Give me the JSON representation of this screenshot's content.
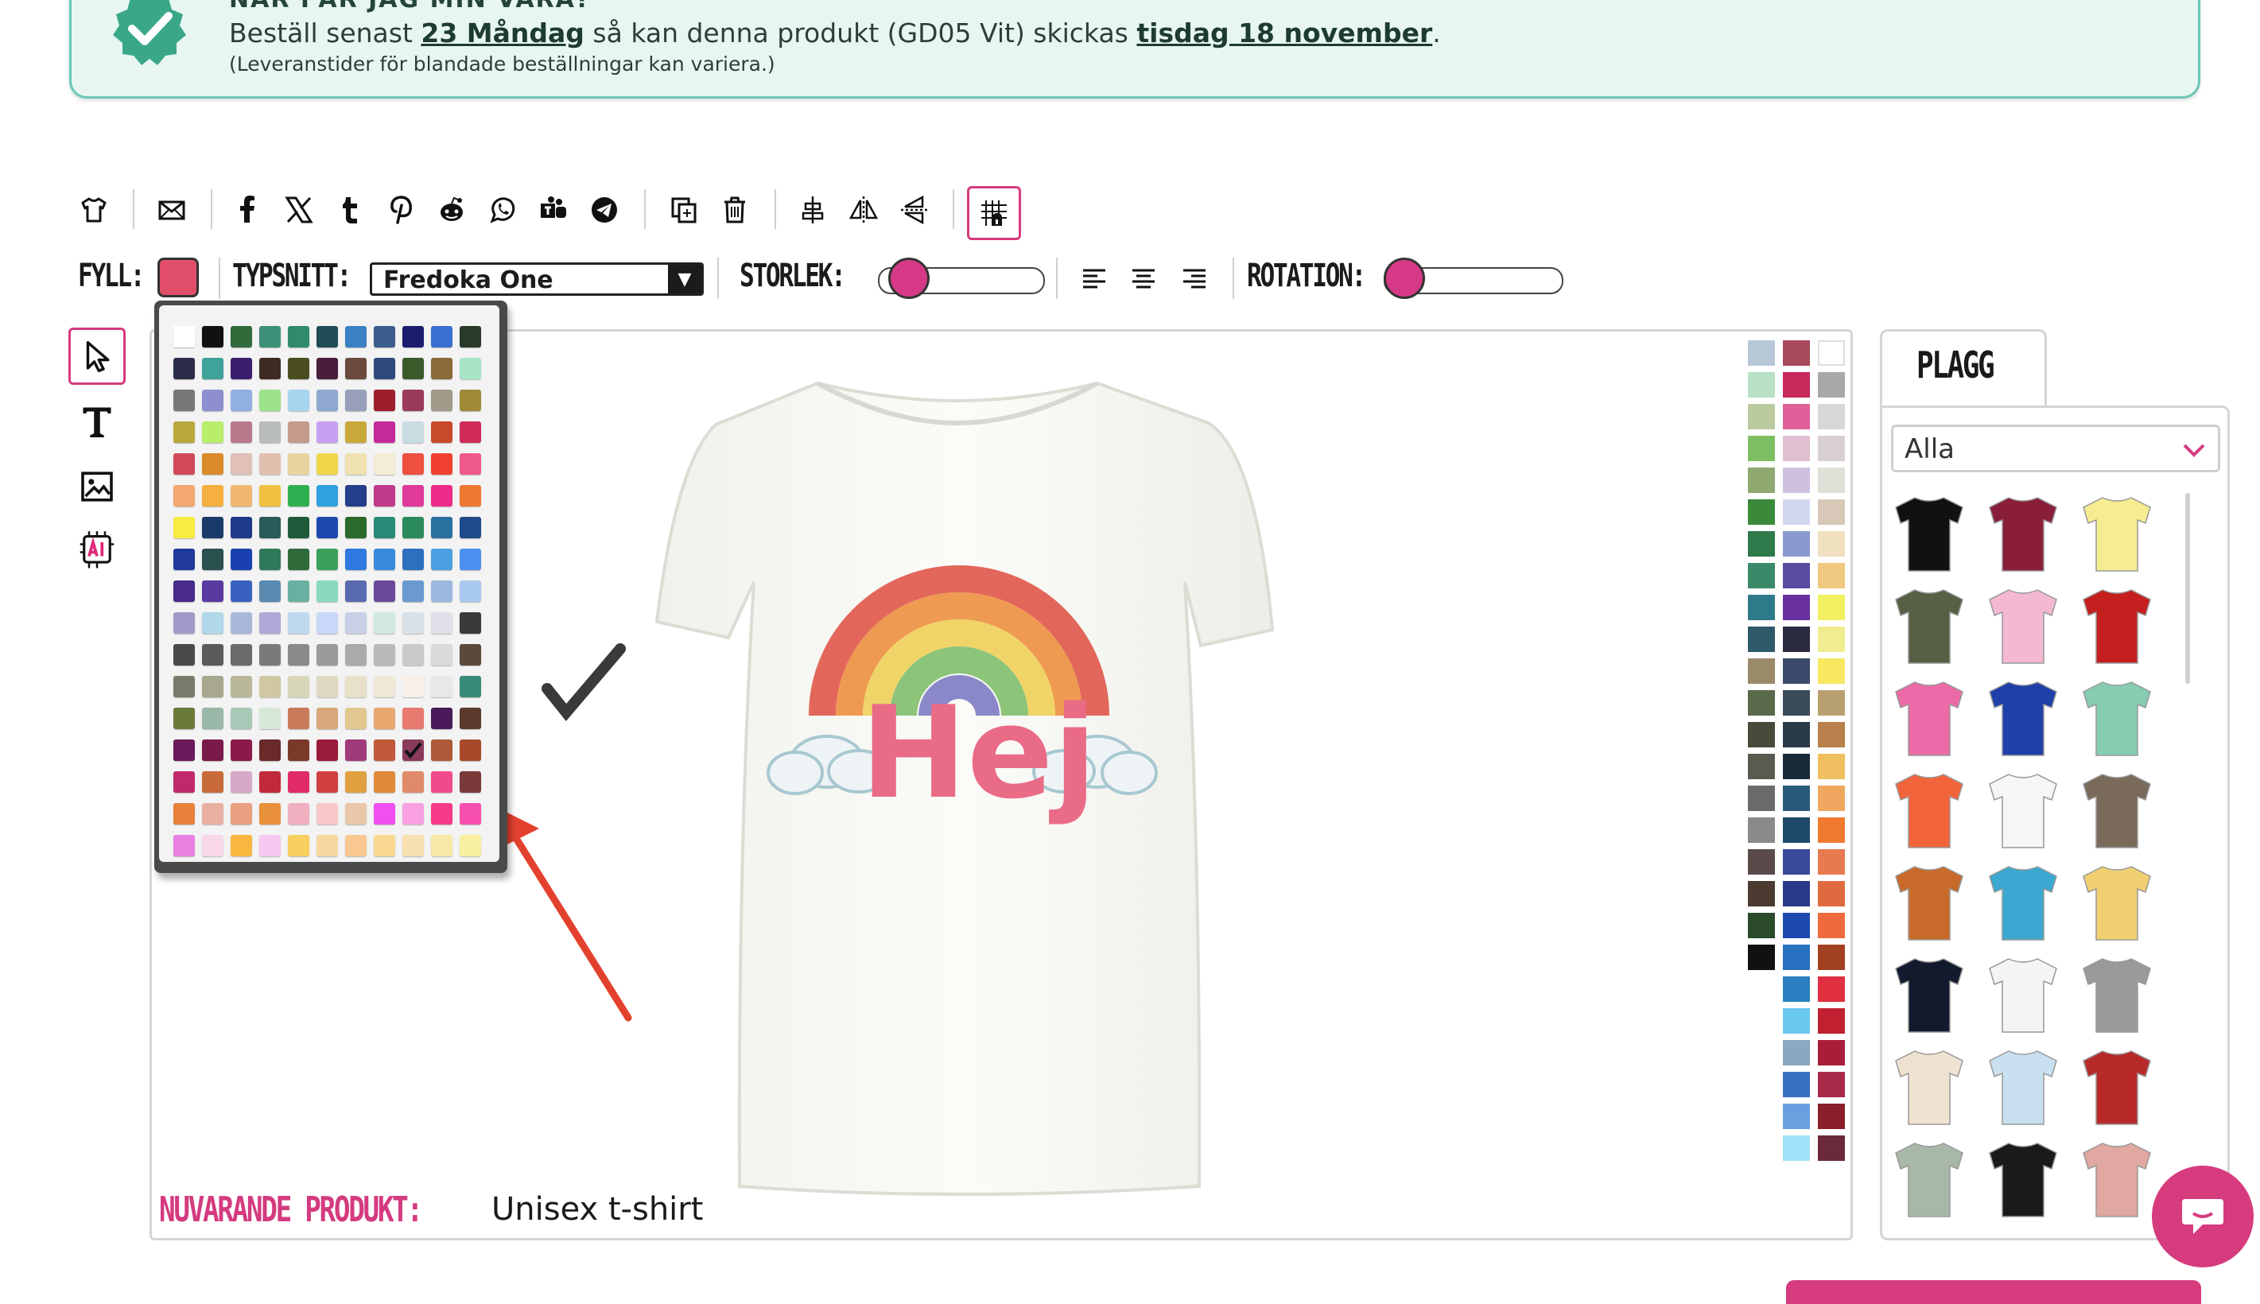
{
  "banner": {
    "title": "NÄR FÅR JAG MIN VARA?",
    "line_prefix": "Beställ senast ",
    "deadline": "23 Måndag",
    "line_middle": " så kan denna produkt (GD05 Vit) skickas ",
    "ship_date": "tisdag 18 november",
    "line_suffix": ".",
    "note": "(Leveranstider för blandade beställningar kan variera.)"
  },
  "toolbar_icons": [
    "tshirt-icon",
    "mail-icon",
    "facebook-icon",
    "x-icon",
    "tumblr-icon",
    "pinterest-icon",
    "reddit-icon",
    "whatsapp-icon",
    "teams-icon",
    "telegram-icon",
    "duplicate-icon",
    "trash-icon",
    "align-center-icon",
    "flip-horizontal-icon",
    "flip-vertical-icon",
    "snap-grid-icon"
  ],
  "props": {
    "fill_label": "FYLL:",
    "fill_color": "#e14e6a",
    "font_label": "TYPSNITT:",
    "font_value": "Fredoka One",
    "size_label": "STORLEK:",
    "size_level": 0.1,
    "rotation_label": "ROTATION:",
    "rotation_level": 0.0
  },
  "tools": [
    "select-tool-icon",
    "text-tool-icon",
    "image-tool-icon",
    "ai-tool-icon"
  ],
  "palette_popup": {
    "selected_index": 151,
    "colors": [
      "#ffffff",
      "#111111",
      "#2f6a3a",
      "#3d8f77",
      "#2f8a6e",
      "#1f4c57",
      "#3b7fc4",
      "#3a5c8e",
      "#1b1e6e",
      "#3a6fd0",
      "#2a3a2a",
      "#2b2d4a",
      "#3fa39a",
      "#3b1e6b",
      "#3d2b22",
      "#4b4d1f",
      "#4a1d3c",
      "#6b4a3e",
      "#2d4a7a",
      "#3b5a2a",
      "#8b6a3b",
      "#a8e4c8",
      "#777777",
      "#8f8fcf",
      "#8fb0e0",
      "#9be28a",
      "#a7d4ee",
      "#8fa8d0",
      "#97a0b8",
      "#9b1e2a",
      "#9a3b5a",
      "#a29a8a",
      "#a08a3a",
      "#b8a83a",
      "#b8ee6a",
      "#b87a8a",
      "#b8bcba",
      "#c49a8a",
      "#c7a0f2",
      "#c9a83a",
      "#c42a9a",
      "#c8dce2",
      "#c84a2a",
      "#cf2a5a",
      "#d24a5a",
      "#db8a2a",
      "#e0c0b8",
      "#e2c0b0",
      "#e7d4a0",
      "#f0d84a",
      "#f0e2b0",
      "#f5ecd8",
      "#ef5040",
      "#f04030",
      "#f05a8a",
      "#f2a870",
      "#f5b040",
      "#f0b870",
      "#f0c040",
      "#2fb050",
      "#2fa0e0",
      "#243e8a",
      "#c03a8a",
      "#e03a9a",
      "#f02a8a",
      "#f07830",
      "#f8ec40",
      "#1a3a6a",
      "#1e3a8a",
      "#2a5a5a",
      "#1e5a3a",
      "#1e4ab0",
      "#2a6a2a",
      "#2a8a7a",
      "#2a8a5a",
      "#2a70a0",
      "#1e4a8a",
      "#1f3a9a",
      "#2a5050",
      "#1a40b0",
      "#2e7a5a",
      "#2e6a3a",
      "#3aa05a",
      "#2e7ae0",
      "#3a8ae0",
      "#2e70c0",
      "#4aa0e0",
      "#4a90f0",
      "#4a2a8a",
      "#5a3aa0",
      "#3a60c0",
      "#5a8ab0",
      "#6ab0a0",
      "#8ad8c0",
      "#5a6ab0",
      "#6a4a9a",
      "#6a9ad0",
      "#9ab8e0",
      "#a8c8f0",
      "#a09ac8",
      "#b0d8e8",
      "#a8b8d8",
      "#b0a8d8",
      "#c0d8f0",
      "#c8d8f8",
      "#c8d0e8",
      "#d0e8e0",
      "#d8e0e8",
      "#e0e0e8",
      "#3a3a3a",
      "#4a4a4a",
      "#5a5a5a",
      "#6a6a6a",
      "#7a7a7a",
      "#8a8a8a",
      "#9a9a9a",
      "#aaaaaa",
      "#bababa",
      "#cacaca",
      "#dadada",
      "#5a4a3a",
      "#7a7a6a",
      "#a8a890",
      "#b8b898",
      "#d0c8a0",
      "#d8d8b8",
      "#e0d8c0",
      "#e8e0c8",
      "#f0e8d8",
      "#f8f0e8",
      "#e8e8e8",
      "#3a8a7a",
      "#6a7a3a",
      "#9ab8a8",
      "#a8c8b8",
      "#d8e8d8",
      "#c87a5a",
      "#d8a87a",
      "#e0c890",
      "#e8a870",
      "#e87a70",
      "#4a1a5a",
      "#5a3a2a",
      "#6a1a5a",
      "#7a1a4a",
      "#8a1a4a",
      "#6a2a2a",
      "#7a3a2a",
      "#9a1a3a",
      "#a03a7a",
      "#c05a3a",
      "#8a3a5a",
      "#b05a3a",
      "#a84a2a",
      "#c02a6a",
      "#c86a3a",
      "#d8a8c8",
      "#c02a3a",
      "#e02a6a",
      "#d04040",
      "#e0a040",
      "#e08a3a",
      "#e08a6a",
      "#f04a8a",
      "#7a3a3a",
      "#e8803a",
      "#e8b0a0",
      "#e8a080",
      "#e8903a",
      "#f0b0c0",
      "#f8c8c8",
      "#e8c8a8",
      "#f050f0",
      "#f8a0e0",
      "#f83a8a",
      "#f850b0",
      "#e880e0",
      "#f8d8e8",
      "#f8b840",
      "#f8c8f0",
      "#f8d060",
      "#f8d8a0",
      "#f8c890",
      "#f8d890",
      "#f8e0b0",
      "#f8e8a8",
      "#f8f0a0"
    ]
  },
  "right_palette": {
    "col1": [
      "#b7c7d8",
      "#b8e0c4",
      "#bccaa0",
      "#7fbf63",
      "#8ea870",
      "#3a8a3a",
      "#2e7a4a",
      "#3a8a6a",
      "#2e7a8a",
      "#2e5a6a",
      "#9a8a6a",
      "#5a6a4a",
      "#4a4a3a",
      "#5a5a50",
      "#6a6a6a",
      "#8a8a8a",
      "#5a4a4a",
      "#4a3a30",
      "#2a4a2a",
      "#111111"
    ],
    "col2": [
      "#a84a5a",
      "#c8285a",
      "#e0609a",
      "#e0c0d0",
      "#d0c0e0",
      "#d0d8f0",
      "#8a9ad0",
      "#5a4aa0",
      "#6a30a0",
      "#2a2a40",
      "#3a4a6a",
      "#3a4a5a",
      "#2a3a4a",
      "#1a2a3a",
      "#2a5a7a",
      "#1e4a6a",
      "#3a4a9a",
      "#2a3a8a",
      "#1e4ab0",
      "#2a70c0",
      "#2a80c0",
      "#6ac8f0",
      "#8aa8c0",
      "#3a70c0",
      "#6aa0e0",
      "#a0e0f8"
    ],
    "col3": [
      "#ffffff",
      "#a8a8a8",
      "#d8d8d8",
      "#d8d0d0",
      "#e0e0d8",
      "#d8c8b8",
      "#f0e0c0",
      "#f0c880",
      "#f0f060",
      "#f0ec90",
      "#f8e860",
      "#b8a070",
      "#b8804a",
      "#f0c060",
      "#f0a860",
      "#f07a30",
      "#e87a50",
      "#e06a40",
      "#f06a40",
      "#a04020",
      "#e03040",
      "#c02030",
      "#a81e3a",
      "#a82a4a",
      "#8a1e2a",
      "#6a2a3a"
    ]
  },
  "plagg": {
    "tab_label": "PLAGG",
    "filter_value": "Alla",
    "items": [
      {
        "name": "tshirt-black",
        "color": "#111111"
      },
      {
        "name": "tshirt-burgundy",
        "color": "#8a1e3a"
      },
      {
        "name": "tshirt-yellow",
        "color": "#f6ec90"
      },
      {
        "name": "tshirt-olive",
        "color": "#556045"
      },
      {
        "name": "tshirt-pink",
        "color": "#f4b8d2"
      },
      {
        "name": "tshirt-red",
        "color": "#c41e1e"
      },
      {
        "name": "tshirt-fuchsia",
        "color": "#ec6aa8"
      },
      {
        "name": "tshirt-royal",
        "color": "#1e40a8"
      },
      {
        "name": "tshirt-mint",
        "color": "#86cdb0"
      },
      {
        "name": "tshirt-coral",
        "color": "#f2643c"
      },
      {
        "name": "tank-white",
        "color": "#f6f6f6"
      },
      {
        "name": "tank-brown",
        "color": "#7a6a5a"
      },
      {
        "name": "hoodie-orange",
        "color": "#c86a2a"
      },
      {
        "name": "hoodie-turquoise",
        "color": "#3aa8d0"
      },
      {
        "name": "tshirt-tiedye",
        "color": "#f0d070"
      },
      {
        "name": "tshirt-navy",
        "color": "#141a2e"
      },
      {
        "name": "raglan-black-white",
        "color": "#f4f4f4"
      },
      {
        "name": "hoodie-grey",
        "color": "#9a9a9a"
      },
      {
        "name": "tshirt-cream",
        "color": "#f0e2d0"
      },
      {
        "name": "tshirt-ombre",
        "color": "#c8e0f0"
      },
      {
        "name": "varsity-jacket",
        "color": "#b82a2a"
      },
      {
        "name": "sweater-sage",
        "color": "#a8b8a8"
      },
      {
        "name": "hoodie-black-orange",
        "color": "#1a1a1a"
      },
      {
        "name": "tank-rose",
        "color": "#e0a8a0"
      }
    ]
  },
  "current_product": {
    "label": "NUVARANDE PRODUKT:",
    "value": "Unisex t-shirt"
  }
}
